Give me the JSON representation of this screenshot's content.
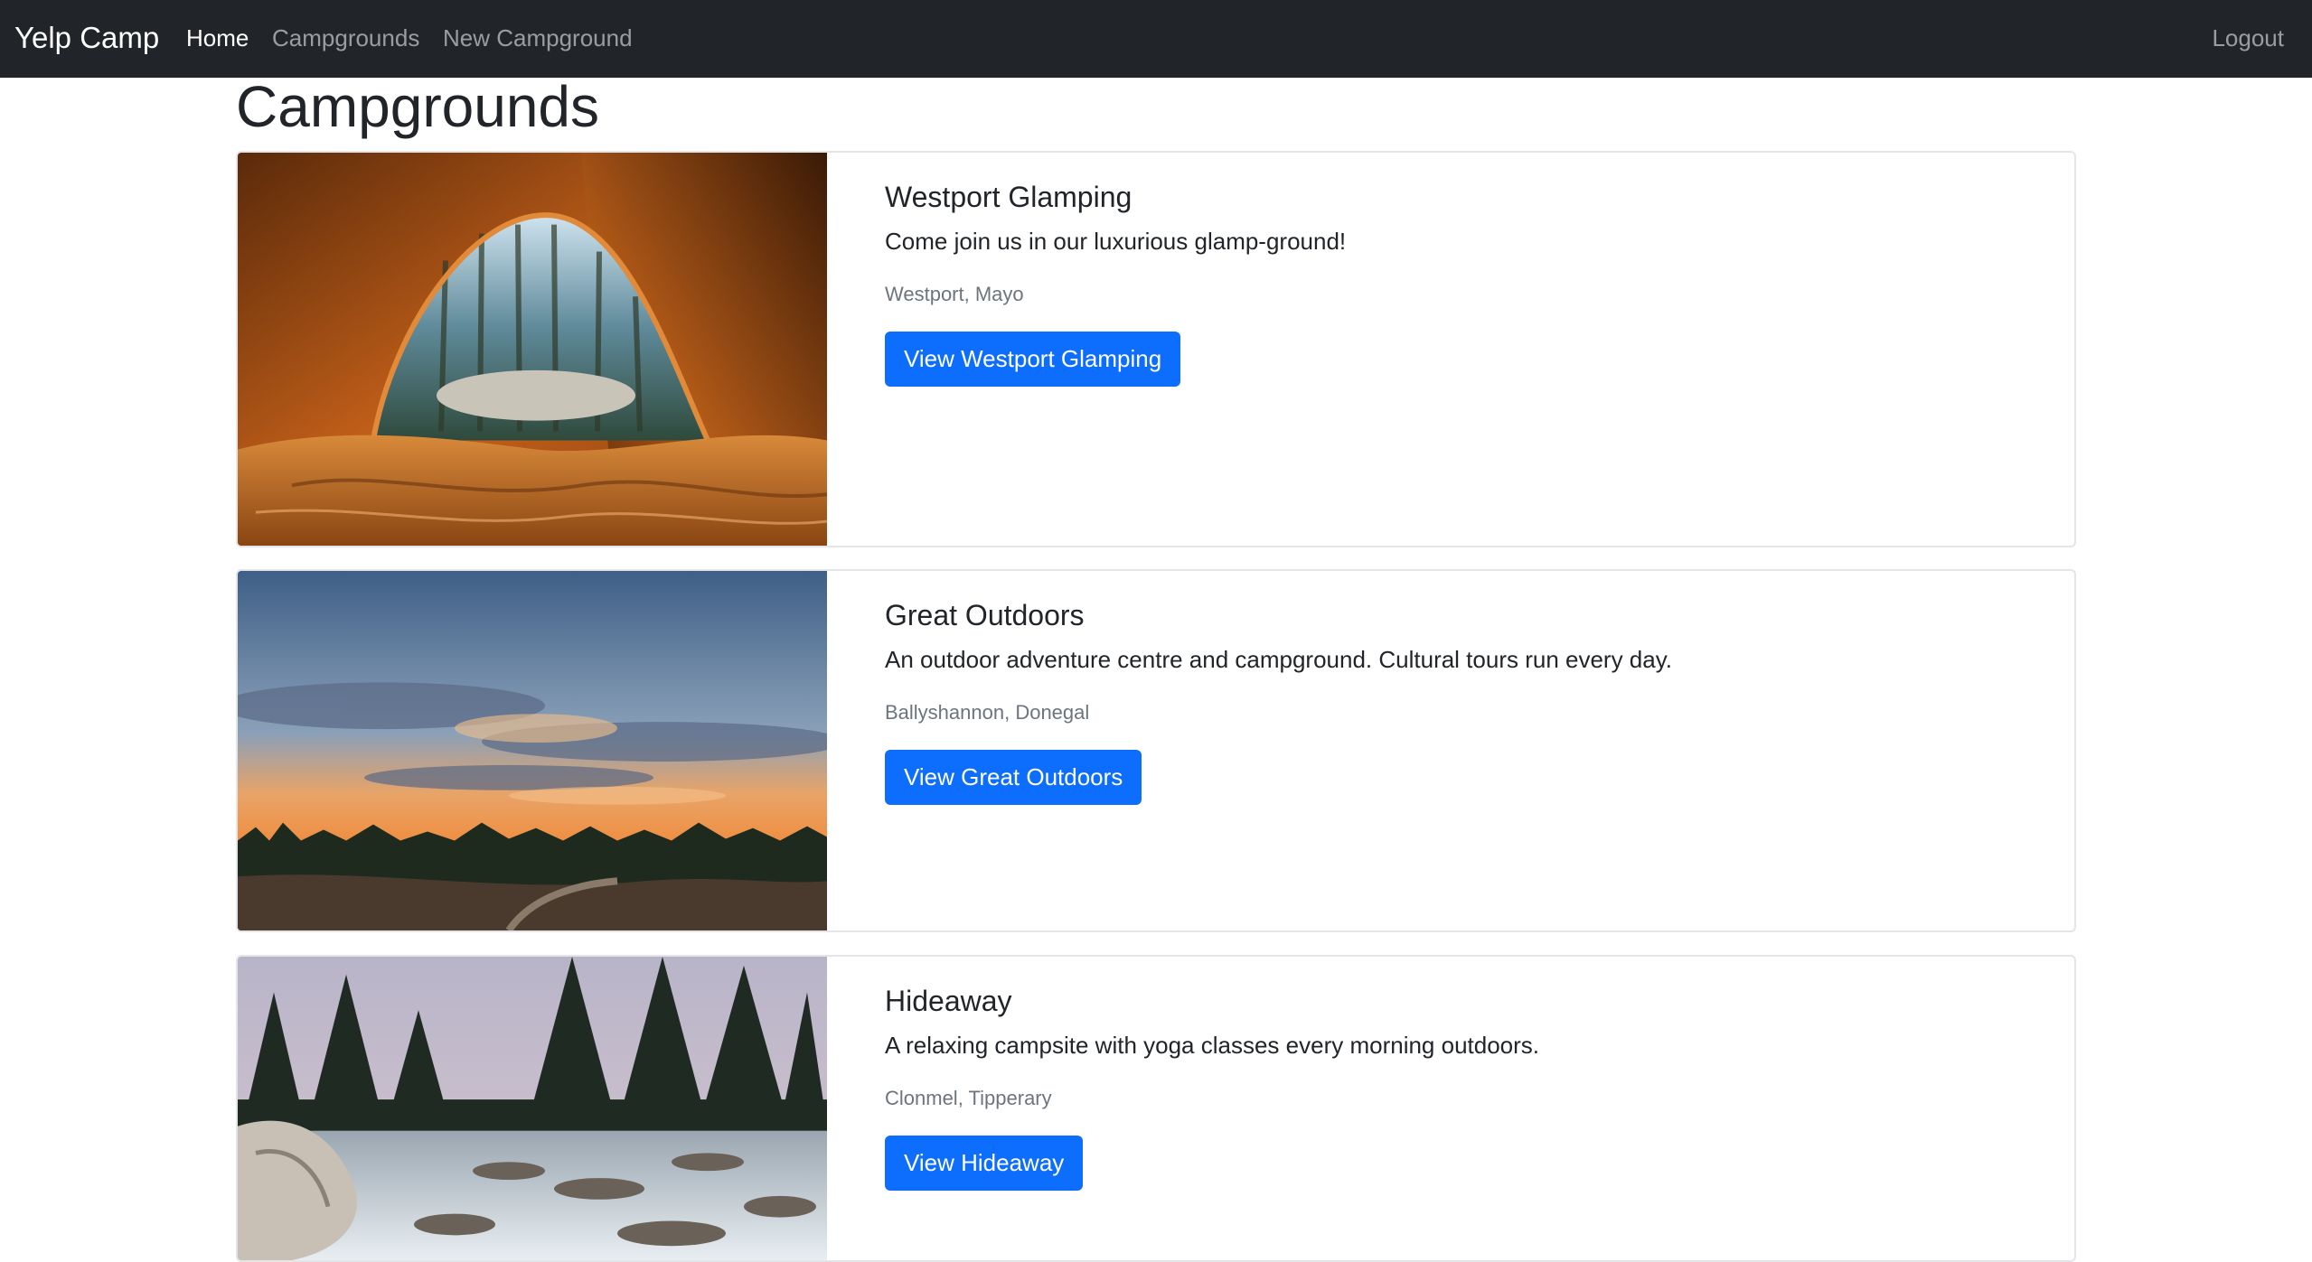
{
  "navbar": {
    "brand": "Yelp Camp",
    "links": [
      {
        "label": "Home",
        "active": true
      },
      {
        "label": "Campgrounds",
        "active": false
      },
      {
        "label": "New Campground",
        "active": false
      }
    ],
    "logout": "Logout"
  },
  "page": {
    "title": "Campgrounds"
  },
  "campgrounds": [
    {
      "title": "Westport Glamping",
      "description": "Come join us in our luxurious glamp-ground!",
      "location": "Westport, Mayo",
      "button": "View Westport Glamping"
    },
    {
      "title": "Great Outdoors",
      "description": "An outdoor adventure centre and campground. Cultural tours run every day.",
      "location": "Ballyshannon, Donegal",
      "button": "View Great Outdoors"
    },
    {
      "title": "Hideaway",
      "description": "A relaxing campsite with yoga classes every morning outdoors.",
      "location": "Clonmel, Tipperary",
      "button": "View Hideaway"
    }
  ],
  "colors": {
    "navbar_bg": "#212529",
    "primary": "#0d6efd",
    "muted": "#6c757d"
  }
}
